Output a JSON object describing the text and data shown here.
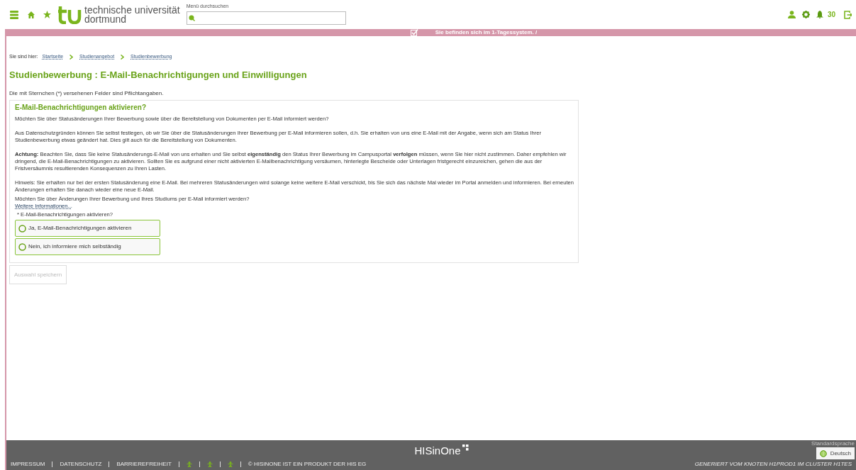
{
  "header": {
    "logo_line1": "technische universität",
    "logo_line2": "dortmund",
    "search": {
      "label": "Menü durchsuchen"
    },
    "notification_count": "30"
  },
  "system_banner": {
    "checked": true,
    "text": "Sie befinden sich im 1-Tagessystem. /"
  },
  "breadcrumb": {
    "label": "Sie sind hier:",
    "items": [
      "Startseite",
      "Studienangebot",
      "Studienbewerbung"
    ]
  },
  "page_title": "Studienbewerbung : E-Mail-Benachrichtigungen und Einwilligungen",
  "required_note": "Die mit Sternchen (*) versehenen Felder sind Pflichtangaben.",
  "panel": {
    "title": "E-Mail-Benachrichtigungen aktivieren?",
    "paragraphs": [
      "Möchten Sie über Statusänderungen Ihrer Bewerbung sowie über die Bereitstellung von Dokumenten per E-Mail informiert werden?",
      "Aus Datenschutzgründen können Sie selbst festlegen, ob wir Sie über die Statusänderungen Ihrer Bewerbung per E-Mail informieren sollen, d.h. Sie erhalten von uns eine E-Mail mit der Angabe, wenn sich am Status Ihrer Studienbewerbung etwas geändert hat. Dies gilt auch für die Bereitstellung von Dokumenten.",
      "**Achtung:** Beachten Sie, dass Sie keine Statusänderungs-E-Mail von uns erhalten und Sie selbst **eigenständig** den Status Ihrer Bewerbung im Campusportal **verfolgen** müssen, wenn Sie hier nicht zustimmen. Daher empfehlen wir dringend, die E-Mail-Benachrichtigungen zu aktivieren. Sollten Sie es aufgrund einer nicht aktivierten E-Mailbenachrichtigung versäumen, hinterlegte Bescheide oder Unterlagen fristgerecht einzureichen, gehen die aus der Fristversäumnis resultierenden Konsequenzen zu Ihren Lasten.",
      "Hinweis: Sie erhalten nur bei der ersten Statusänderung eine E-Mail. Bei mehreren Statusänderungen wird solange keine weitere E-Mail verschickt, bis Sie sich das nächste Mal wieder im Portal anmelden und informieren. Bei erneuten Änderungen erhalten Sie danach wieder eine neue E-Mail."
    ],
    "question": "Möchten Sie über Änderungen Ihrer Bewerbung und Ihres Studiums per E-Mail informiert werden?",
    "more_link": "Weitere Informationen...",
    "field_label": "* E-Mail-Benachrichtigungen aktivieren?",
    "options": [
      {
        "label": "Ja, E-Mail-Benachrichtigungen aktivieren",
        "selected": false
      },
      {
        "label": "Nein, ich informiere mich selbständig",
        "selected": false
      }
    ]
  },
  "save_button": {
    "label": "Auswahl speichern",
    "disabled": true
  },
  "footer": {
    "logo": "HISinOne",
    "links": [
      "IMPRESSUM",
      "DATENSCHUTZ",
      "BARRIEREFREIHEIT"
    ],
    "copyright": "© HISINONE IST EIN PRODUKT DER HIS EG",
    "language_label": "Standardsprache",
    "language_button": "Deutsch",
    "node_info": "GENERIERT VOM KNOTEN H1PROD1 IM CLUSTER H1TES"
  }
}
